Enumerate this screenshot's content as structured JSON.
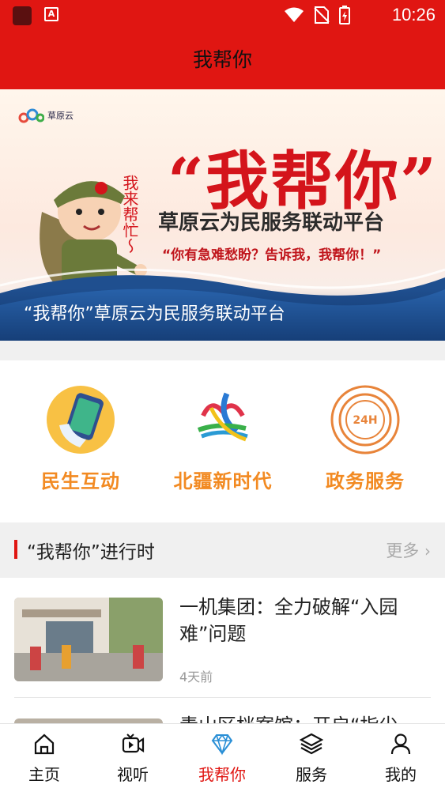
{
  "status": {
    "time": "10:26",
    "app_badge": "A"
  },
  "header": {
    "title": "我帮你"
  },
  "banner": {
    "logo_text": "草原云",
    "headline": "“我帮你”",
    "subtitle": "草原云为民服务联动平台",
    "quote": "“你有急难愁盼？告诉我，我帮你！”",
    "handwriting": "我来帮忙～",
    "caption": "“我帮你”草原云为民服务联动平台"
  },
  "quick_links": [
    {
      "label": "民生互动",
      "icon": "phone-hand-icon"
    },
    {
      "label": "北疆新时代",
      "icon": "beijiang-logo-icon"
    },
    {
      "label": "政务服务",
      "icon": "24h-service-icon"
    }
  ],
  "section": {
    "title": "“我帮你”进行时",
    "more_label": "更多"
  },
  "news": [
    {
      "title": "一机集团：全力破解“入园难”问题",
      "time": "4天前"
    },
    {
      "title": "青山区档案馆：开启“指尖",
      "time": ""
    }
  ],
  "tabs": [
    {
      "label": "主页",
      "icon": "home-icon",
      "active": false
    },
    {
      "label": "视听",
      "icon": "video-icon",
      "active": false
    },
    {
      "label": "我帮你",
      "icon": "diamond-icon",
      "active": true
    },
    {
      "label": "服务",
      "icon": "layers-icon",
      "active": false
    },
    {
      "label": "我的",
      "icon": "person-icon",
      "active": false
    }
  ],
  "colors": {
    "brand_red": "#e01612",
    "accent_orange": "#f28a22",
    "active_tab": "#e01612"
  }
}
